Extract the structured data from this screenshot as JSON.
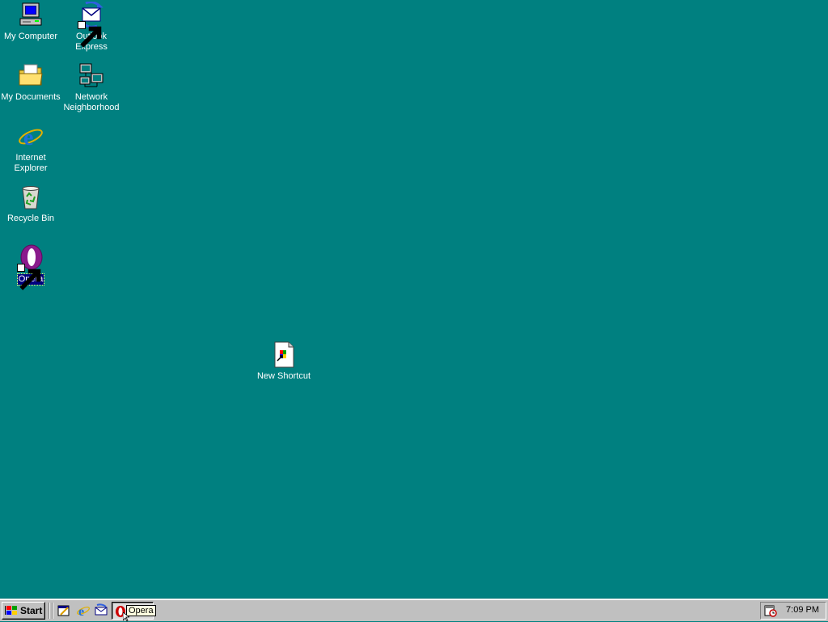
{
  "desktop": {
    "background_color": "#008080",
    "icons": [
      {
        "label": "My Computer",
        "icon": "my-computer-icon"
      },
      {
        "label": "Outlook\nExpress",
        "icon": "outlook-express-icon",
        "shortcut": true
      },
      {
        "label": "My Documents",
        "icon": "my-documents-icon"
      },
      {
        "label": "Network\nNeighborhood",
        "icon": "network-neighborhood-icon"
      },
      {
        "label": "Internet\nExplorer",
        "icon": "internet-explorer-icon"
      },
      {
        "label": "Recycle Bin",
        "icon": "recycle-bin-icon"
      },
      {
        "label": "Opera",
        "icon": "opera-icon",
        "shortcut": true,
        "selected": true
      },
      {
        "label": "New Shortcut",
        "icon": "new-shortcut-icon"
      }
    ]
  },
  "taskbar": {
    "start_label": "Start",
    "quick_launch": [
      "show-desktop-icon",
      "internet-explorer-icon",
      "outlook-express-icon"
    ],
    "task_button_label": "Opera",
    "clock": "7:09 PM",
    "tray_icon": "scheduled-tasks-icon"
  }
}
